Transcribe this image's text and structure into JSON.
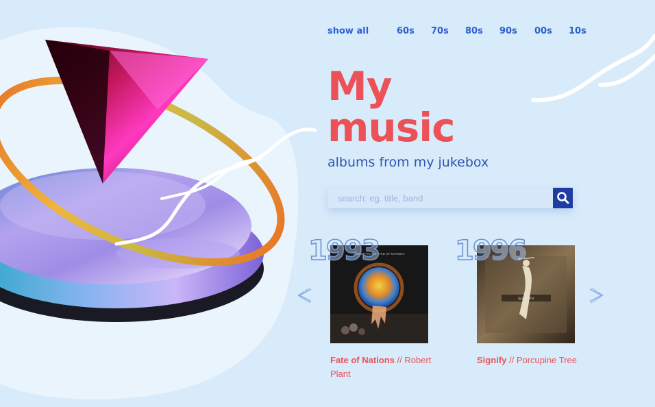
{
  "nav": {
    "items": [
      {
        "label": "show all"
      },
      {
        "label": "60s"
      },
      {
        "label": "70s"
      },
      {
        "label": "80s"
      },
      {
        "label": "90s"
      },
      {
        "label": "00s"
      },
      {
        "label": "10s"
      }
    ]
  },
  "hero": {
    "title_line1": "My",
    "title_line2": "music",
    "subtitle": "albums from my jukebox"
  },
  "search": {
    "placeholder": "search: eg. title, band",
    "icon": "search-icon"
  },
  "carousel": {
    "prev_label": "<",
    "next_label": ">",
    "albums": [
      {
        "year": "1993",
        "title": "Fate of Nations",
        "separator": "//",
        "artist": "Robert Plant",
        "cover_text": "ROBERT PLANT FATE OF NATIONS"
      },
      {
        "year": "1996",
        "title": "Signify",
        "separator": "//",
        "artist": "Porcupine Tree",
        "cover_text": "SIGNIFY"
      }
    ]
  },
  "colors": {
    "background": "#d8ebfb",
    "accent": "#ec5158",
    "nav": "#2d5fcf",
    "subtitle": "#2f55b0",
    "search_button": "#1e3da4"
  }
}
